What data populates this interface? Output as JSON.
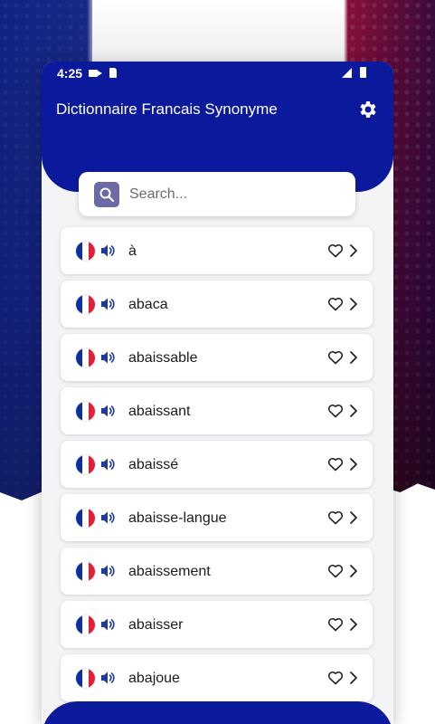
{
  "status_bar": {
    "time": "4:25"
  },
  "header": {
    "title": "Dictionnaire Francais Synonyme"
  },
  "search": {
    "placeholder": "Search..."
  },
  "words": [
    {
      "label": "à"
    },
    {
      "label": "abaca"
    },
    {
      "label": "abaissable"
    },
    {
      "label": "abaissant"
    },
    {
      "label": "abaissé"
    },
    {
      "label": "abaisse-langue"
    },
    {
      "label": "abaissement"
    },
    {
      "label": "abaisser"
    },
    {
      "label": "abajoue"
    }
  ],
  "icons": {
    "settings": "gear-icon",
    "search": "search-icon",
    "flag": "french-flag-icon",
    "audio": "speaker-icon",
    "favorite": "heart-icon",
    "open": "chevron-right-icon"
  },
  "colors": {
    "primary": "#0b1a9c",
    "search_icon_bg": "#6b6aa6",
    "audio_icon": "#1e3a9a",
    "flag_blue": "#0b2ea0",
    "flag_red": "#e0203a"
  }
}
